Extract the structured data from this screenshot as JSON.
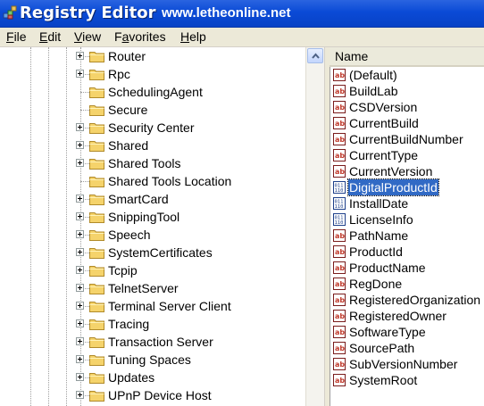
{
  "window": {
    "title": "Registry Editor",
    "subtitle": "www.letheonline.net",
    "icon": "regedit-icon"
  },
  "menu": [
    {
      "accel": "F",
      "rest": "ile"
    },
    {
      "accel": "E",
      "rest": "dit"
    },
    {
      "accel": "V",
      "rest": "iew"
    },
    {
      "pre": "F",
      "accel": "a",
      "rest": "vorites"
    },
    {
      "accel": "H",
      "rest": "elp"
    }
  ],
  "tree": {
    "items": [
      {
        "label": "Router",
        "expandable": true
      },
      {
        "label": "Rpc",
        "expandable": true
      },
      {
        "label": "SchedulingAgent",
        "expandable": false
      },
      {
        "label": "Secure",
        "expandable": false
      },
      {
        "label": "Security Center",
        "expandable": true
      },
      {
        "label": "Shared",
        "expandable": true
      },
      {
        "label": "Shared Tools",
        "expandable": true
      },
      {
        "label": "Shared Tools Location",
        "expandable": false
      },
      {
        "label": "SmartCard",
        "expandable": true
      },
      {
        "label": "SnippingTool",
        "expandable": true
      },
      {
        "label": "Speech",
        "expandable": true
      },
      {
        "label": "SystemCertificates",
        "expandable": true
      },
      {
        "label": "Tcpip",
        "expandable": true
      },
      {
        "label": "TelnetServer",
        "expandable": true
      },
      {
        "label": "Terminal Server Client",
        "expandable": true
      },
      {
        "label": "Tracing",
        "expandable": true
      },
      {
        "label": "Transaction Server",
        "expandable": true
      },
      {
        "label": "Tuning Spaces",
        "expandable": true
      },
      {
        "label": "Updates",
        "expandable": true
      },
      {
        "label": "UPnP Device Host",
        "expandable": true
      }
    ]
  },
  "list": {
    "column_header": "Name",
    "selected_index": 7,
    "items": [
      {
        "label": "(Default)",
        "type": "string"
      },
      {
        "label": "BuildLab",
        "type": "string"
      },
      {
        "label": "CSDVersion",
        "type": "string"
      },
      {
        "label": "CurrentBuild",
        "type": "string"
      },
      {
        "label": "CurrentBuildNumber",
        "type": "string"
      },
      {
        "label": "CurrentType",
        "type": "string"
      },
      {
        "label": "CurrentVersion",
        "type": "string"
      },
      {
        "label": "DigitalProductId",
        "type": "binary"
      },
      {
        "label": "InstallDate",
        "type": "binary"
      },
      {
        "label": "LicenseInfo",
        "type": "binary"
      },
      {
        "label": "PathName",
        "type": "string"
      },
      {
        "label": "ProductId",
        "type": "string"
      },
      {
        "label": "ProductName",
        "type": "string"
      },
      {
        "label": "RegDone",
        "type": "string"
      },
      {
        "label": "RegisteredOrganization",
        "type": "string"
      },
      {
        "label": "RegisteredOwner",
        "type": "string"
      },
      {
        "label": "SoftwareType",
        "type": "string"
      },
      {
        "label": "SourcePath",
        "type": "string"
      },
      {
        "label": "SubVersionNumber",
        "type": "string"
      },
      {
        "label": "SystemRoot",
        "type": "string"
      }
    ]
  },
  "colors": {
    "titlebar": "#0a4ad6",
    "selection": "#316ac5",
    "folder": "#f5d36b",
    "menubar": "#ece9d8"
  }
}
